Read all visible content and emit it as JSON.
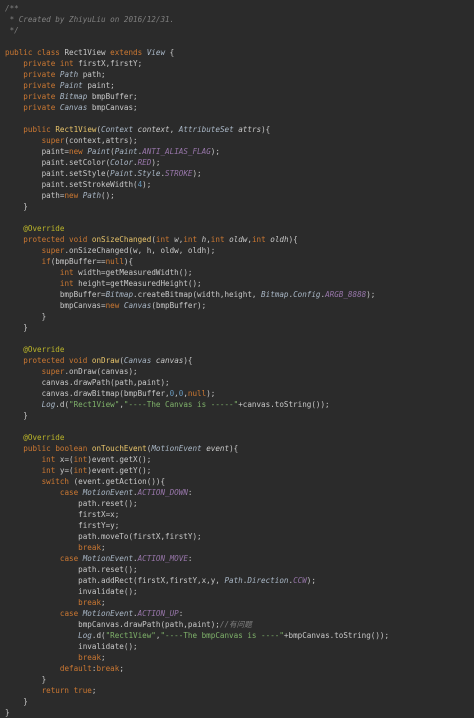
{
  "editor": {
    "language": "java",
    "colors": {
      "background": "#2b2b2b",
      "keyword": "#cc7832",
      "type": "#a9b7c6",
      "method": "#e8c46a",
      "string": "#7fb26a",
      "number": "#6897bb",
      "constant": "#9876aa",
      "comment": "#808080",
      "annotation": "#bbb529",
      "text": "#c8c8c8"
    },
    "lines": [
      [
        {
          "t": "cmt",
          "v": "/**"
        }
      ],
      [
        {
          "t": "cmt",
          "v": " * Created by ZhiyuLiu on 2016/12/31."
        }
      ],
      [
        {
          "t": "cmt",
          "v": " */"
        }
      ],
      [
        {
          "t": "plain",
          "v": ""
        }
      ],
      [
        {
          "t": "kw",
          "v": "public class "
        },
        {
          "t": "plain",
          "v": "Rect1View "
        },
        {
          "t": "kw",
          "v": "extends "
        },
        {
          "t": "type",
          "v": "View"
        },
        {
          "t": "plain",
          "v": " {"
        }
      ],
      [
        {
          "t": "plain",
          "v": "    "
        },
        {
          "t": "kw",
          "v": "private "
        },
        {
          "t": "kw",
          "v": "int "
        },
        {
          "t": "plain",
          "v": "firstX,firstY;"
        }
      ],
      [
        {
          "t": "plain",
          "v": "    "
        },
        {
          "t": "kw",
          "v": "private "
        },
        {
          "t": "type",
          "v": "Path "
        },
        {
          "t": "plain",
          "v": "path;"
        }
      ],
      [
        {
          "t": "plain",
          "v": "    "
        },
        {
          "t": "kw",
          "v": "private "
        },
        {
          "t": "type",
          "v": "Paint "
        },
        {
          "t": "plain",
          "v": "paint;"
        }
      ],
      [
        {
          "t": "plain",
          "v": "    "
        },
        {
          "t": "kw",
          "v": "private "
        },
        {
          "t": "type",
          "v": "Bitmap "
        },
        {
          "t": "plain",
          "v": "bmpBuffer;"
        }
      ],
      [
        {
          "t": "plain",
          "v": "    "
        },
        {
          "t": "kw",
          "v": "private "
        },
        {
          "t": "type",
          "v": "Canvas "
        },
        {
          "t": "plain",
          "v": "bmpCanvas;"
        }
      ],
      [
        {
          "t": "plain",
          "v": ""
        }
      ],
      [
        {
          "t": "plain",
          "v": "    "
        },
        {
          "t": "kw",
          "v": "public "
        },
        {
          "t": "fn",
          "v": "Rect1View"
        },
        {
          "t": "plain",
          "v": "("
        },
        {
          "t": "type",
          "v": "Context "
        },
        {
          "t": "param",
          "v": "context"
        },
        {
          "t": "plain",
          "v": ", "
        },
        {
          "t": "type",
          "v": "AttributeSet "
        },
        {
          "t": "param",
          "v": "attrs"
        },
        {
          "t": "plain",
          "v": "){"
        }
      ],
      [
        {
          "t": "plain",
          "v": "        "
        },
        {
          "t": "kw",
          "v": "super"
        },
        {
          "t": "plain",
          "v": "(context,attrs);"
        }
      ],
      [
        {
          "t": "plain",
          "v": "        paint="
        },
        {
          "t": "kw",
          "v": "new "
        },
        {
          "t": "type",
          "v": "Paint"
        },
        {
          "t": "plain",
          "v": "("
        },
        {
          "t": "type",
          "v": "Paint"
        },
        {
          "t": "plain",
          "v": "."
        },
        {
          "t": "const",
          "v": "ANTI_ALIAS_FLAG"
        },
        {
          "t": "plain",
          "v": ");"
        }
      ],
      [
        {
          "t": "plain",
          "v": "        paint.setColor("
        },
        {
          "t": "type",
          "v": "Color"
        },
        {
          "t": "plain",
          "v": "."
        },
        {
          "t": "const",
          "v": "RED"
        },
        {
          "t": "plain",
          "v": ");"
        }
      ],
      [
        {
          "t": "plain",
          "v": "        paint.setStyle("
        },
        {
          "t": "type",
          "v": "Paint"
        },
        {
          "t": "plain",
          "v": "."
        },
        {
          "t": "type",
          "v": "Style"
        },
        {
          "t": "plain",
          "v": "."
        },
        {
          "t": "const",
          "v": "STROKE"
        },
        {
          "t": "plain",
          "v": ");"
        }
      ],
      [
        {
          "t": "plain",
          "v": "        paint.setStrokeWidth("
        },
        {
          "t": "num",
          "v": "4"
        },
        {
          "t": "plain",
          "v": ");"
        }
      ],
      [
        {
          "t": "plain",
          "v": "        path="
        },
        {
          "t": "kw",
          "v": "new "
        },
        {
          "t": "type",
          "v": "Path"
        },
        {
          "t": "plain",
          "v": "();"
        }
      ],
      [
        {
          "t": "plain",
          "v": "    }"
        }
      ],
      [
        {
          "t": "plain",
          "v": ""
        }
      ],
      [
        {
          "t": "plain",
          "v": "    "
        },
        {
          "t": "ann",
          "v": "@Override"
        }
      ],
      [
        {
          "t": "plain",
          "v": "    "
        },
        {
          "t": "kw",
          "v": "protected "
        },
        {
          "t": "kw",
          "v": "void "
        },
        {
          "t": "fn",
          "v": "onSizeChanged"
        },
        {
          "t": "plain",
          "v": "("
        },
        {
          "t": "kw",
          "v": "int "
        },
        {
          "t": "param",
          "v": "w"
        },
        {
          "t": "plain",
          "v": ","
        },
        {
          "t": "kw",
          "v": "int "
        },
        {
          "t": "param",
          "v": "h"
        },
        {
          "t": "plain",
          "v": ","
        },
        {
          "t": "kw",
          "v": "int "
        },
        {
          "t": "param",
          "v": "oldw"
        },
        {
          "t": "plain",
          "v": ","
        },
        {
          "t": "kw",
          "v": "int "
        },
        {
          "t": "param",
          "v": "oldh"
        },
        {
          "t": "plain",
          "v": "){"
        }
      ],
      [
        {
          "t": "plain",
          "v": "        "
        },
        {
          "t": "kw",
          "v": "super"
        },
        {
          "t": "plain",
          "v": ".onSizeChanged(w, h, oldw, oldh);"
        }
      ],
      [
        {
          "t": "plain",
          "v": "        "
        },
        {
          "t": "kw",
          "v": "if"
        },
        {
          "t": "plain",
          "v": "(bmpBuffer=="
        },
        {
          "t": "kw",
          "v": "null"
        },
        {
          "t": "plain",
          "v": "){"
        }
      ],
      [
        {
          "t": "plain",
          "v": "            "
        },
        {
          "t": "kw",
          "v": "int "
        },
        {
          "t": "plain",
          "v": "width=getMeasuredWidth();"
        }
      ],
      [
        {
          "t": "plain",
          "v": "            "
        },
        {
          "t": "kw",
          "v": "int "
        },
        {
          "t": "plain",
          "v": "height=getMeasuredHeight();"
        }
      ],
      [
        {
          "t": "plain",
          "v": "            bmpBuffer="
        },
        {
          "t": "type",
          "v": "Bitmap"
        },
        {
          "t": "plain",
          "v": ".createBitmap(width,height, "
        },
        {
          "t": "type",
          "v": "Bitmap"
        },
        {
          "t": "plain",
          "v": "."
        },
        {
          "t": "type",
          "v": "Config"
        },
        {
          "t": "plain",
          "v": "."
        },
        {
          "t": "const",
          "v": "ARGB_8888"
        },
        {
          "t": "plain",
          "v": ");"
        }
      ],
      [
        {
          "t": "plain",
          "v": "            bmpCanvas="
        },
        {
          "t": "kw",
          "v": "new "
        },
        {
          "t": "type",
          "v": "Canvas"
        },
        {
          "t": "plain",
          "v": "(bmpBuffer);"
        }
      ],
      [
        {
          "t": "plain",
          "v": "        }"
        }
      ],
      [
        {
          "t": "plain",
          "v": "    }"
        }
      ],
      [
        {
          "t": "plain",
          "v": ""
        }
      ],
      [
        {
          "t": "plain",
          "v": "    "
        },
        {
          "t": "ann",
          "v": "@Override"
        }
      ],
      [
        {
          "t": "plain",
          "v": "    "
        },
        {
          "t": "kw",
          "v": "protected "
        },
        {
          "t": "kw",
          "v": "void "
        },
        {
          "t": "fn",
          "v": "onDraw"
        },
        {
          "t": "plain",
          "v": "("
        },
        {
          "t": "type",
          "v": "Canvas "
        },
        {
          "t": "param",
          "v": "canvas"
        },
        {
          "t": "plain",
          "v": "){"
        }
      ],
      [
        {
          "t": "plain",
          "v": "        "
        },
        {
          "t": "kw",
          "v": "super"
        },
        {
          "t": "plain",
          "v": ".onDraw(canvas);"
        }
      ],
      [
        {
          "t": "plain",
          "v": "        canvas.drawPath(path,paint);"
        }
      ],
      [
        {
          "t": "plain",
          "v": "        canvas.drawBitmap(bmpBuffer,"
        },
        {
          "t": "num",
          "v": "0"
        },
        {
          "t": "plain",
          "v": ","
        },
        {
          "t": "num",
          "v": "0"
        },
        {
          "t": "plain",
          "v": ","
        },
        {
          "t": "kw",
          "v": "null"
        },
        {
          "t": "plain",
          "v": ");"
        }
      ],
      [
        {
          "t": "plain",
          "v": "        "
        },
        {
          "t": "type",
          "v": "Log"
        },
        {
          "t": "plain",
          "v": ".d("
        },
        {
          "t": "str",
          "v": "\"Rect1View\""
        },
        {
          "t": "plain",
          "v": ","
        },
        {
          "t": "str",
          "v": "\"----The Canvas is -----\""
        },
        {
          "t": "plain",
          "v": "+canvas.toString());"
        }
      ],
      [
        {
          "t": "plain",
          "v": "    }"
        }
      ],
      [
        {
          "t": "plain",
          "v": ""
        }
      ],
      [
        {
          "t": "plain",
          "v": "    "
        },
        {
          "t": "ann",
          "v": "@Override"
        }
      ],
      [
        {
          "t": "plain",
          "v": "    "
        },
        {
          "t": "kw",
          "v": "public "
        },
        {
          "t": "kw",
          "v": "boolean "
        },
        {
          "t": "fn",
          "v": "onTouchEvent"
        },
        {
          "t": "plain",
          "v": "("
        },
        {
          "t": "type",
          "v": "MotionEvent "
        },
        {
          "t": "param",
          "v": "event"
        },
        {
          "t": "plain",
          "v": "){"
        }
      ],
      [
        {
          "t": "plain",
          "v": "        "
        },
        {
          "t": "kw",
          "v": "int "
        },
        {
          "t": "plain",
          "v": "x=("
        },
        {
          "t": "kw",
          "v": "int"
        },
        {
          "t": "plain",
          "v": ")event.getX();"
        }
      ],
      [
        {
          "t": "plain",
          "v": "        "
        },
        {
          "t": "kw",
          "v": "int "
        },
        {
          "t": "plain",
          "v": "y=("
        },
        {
          "t": "kw",
          "v": "int"
        },
        {
          "t": "plain",
          "v": ")event.getY();"
        }
      ],
      [
        {
          "t": "plain",
          "v": "        "
        },
        {
          "t": "kw",
          "v": "switch "
        },
        {
          "t": "plain",
          "v": "(event.getAction()){"
        }
      ],
      [
        {
          "t": "plain",
          "v": "            "
        },
        {
          "t": "kw",
          "v": "case "
        },
        {
          "t": "type",
          "v": "MotionEvent"
        },
        {
          "t": "plain",
          "v": "."
        },
        {
          "t": "const",
          "v": "ACTION_DOWN"
        },
        {
          "t": "plain",
          "v": ":"
        }
      ],
      [
        {
          "t": "plain",
          "v": "                path.reset();"
        }
      ],
      [
        {
          "t": "plain",
          "v": "                firstX=x;"
        }
      ],
      [
        {
          "t": "plain",
          "v": "                firstY=y;"
        }
      ],
      [
        {
          "t": "plain",
          "v": "                path.moveTo(firstX,firstY);"
        }
      ],
      [
        {
          "t": "plain",
          "v": "                "
        },
        {
          "t": "kw",
          "v": "break"
        },
        {
          "t": "plain",
          "v": ";"
        }
      ],
      [
        {
          "t": "plain",
          "v": "            "
        },
        {
          "t": "kw",
          "v": "case "
        },
        {
          "t": "type",
          "v": "MotionEvent"
        },
        {
          "t": "plain",
          "v": "."
        },
        {
          "t": "const",
          "v": "ACTION_MOVE"
        },
        {
          "t": "plain",
          "v": ":"
        }
      ],
      [
        {
          "t": "plain",
          "v": "                path.reset();"
        }
      ],
      [
        {
          "t": "plain",
          "v": "                path.addRect(firstX,firstY,x,y, "
        },
        {
          "t": "type",
          "v": "Path"
        },
        {
          "t": "plain",
          "v": "."
        },
        {
          "t": "type",
          "v": "Direction"
        },
        {
          "t": "plain",
          "v": "."
        },
        {
          "t": "const",
          "v": "CCW"
        },
        {
          "t": "plain",
          "v": ");"
        }
      ],
      [
        {
          "t": "plain",
          "v": "                invalidate();"
        }
      ],
      [
        {
          "t": "plain",
          "v": "                "
        },
        {
          "t": "kw",
          "v": "break"
        },
        {
          "t": "plain",
          "v": ";"
        }
      ],
      [
        {
          "t": "plain",
          "v": "            "
        },
        {
          "t": "kw",
          "v": "case "
        },
        {
          "t": "type",
          "v": "MotionEvent"
        },
        {
          "t": "plain",
          "v": "."
        },
        {
          "t": "const",
          "v": "ACTION_UP"
        },
        {
          "t": "plain",
          "v": ":"
        }
      ],
      [
        {
          "t": "plain",
          "v": "                bmpCanvas.drawPath(path,paint);"
        },
        {
          "t": "cmt",
          "v": "//有问题"
        }
      ],
      [
        {
          "t": "plain",
          "v": "                "
        },
        {
          "t": "type",
          "v": "Log"
        },
        {
          "t": "plain",
          "v": ".d("
        },
        {
          "t": "str",
          "v": "\"Rect1View\""
        },
        {
          "t": "plain",
          "v": ","
        },
        {
          "t": "str",
          "v": "\"----The bmpCanvas is ----\""
        },
        {
          "t": "plain",
          "v": "+bmpCanvas.toString());"
        }
      ],
      [
        {
          "t": "plain",
          "v": "                invalidate();"
        }
      ],
      [
        {
          "t": "plain",
          "v": "                "
        },
        {
          "t": "kw",
          "v": "break"
        },
        {
          "t": "plain",
          "v": ";"
        }
      ],
      [
        {
          "t": "plain",
          "v": "            "
        },
        {
          "t": "kw",
          "v": "default"
        },
        {
          "t": "plain",
          "v": ":"
        },
        {
          "t": "kw",
          "v": "break"
        },
        {
          "t": "plain",
          "v": ";"
        }
      ],
      [
        {
          "t": "plain",
          "v": "        }"
        }
      ],
      [
        {
          "t": "plain",
          "v": "        "
        },
        {
          "t": "kw",
          "v": "return "
        },
        {
          "t": "kw",
          "v": "true"
        },
        {
          "t": "plain",
          "v": ";"
        }
      ],
      [
        {
          "t": "plain",
          "v": "    }"
        }
      ],
      [
        {
          "t": "plain",
          "v": "}"
        }
      ]
    ]
  }
}
